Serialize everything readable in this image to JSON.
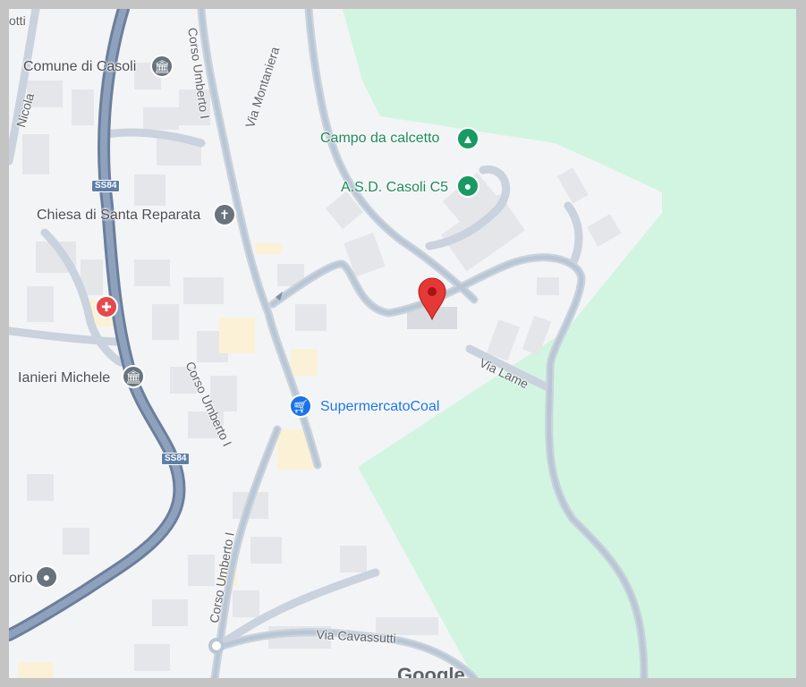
{
  "map": {
    "streets": {
      "corso_umberto_top": "Corso Umberto I",
      "via_montaniera": "Via Montaniera",
      "corso_umberto_mid": "Corso Umberto I",
      "corso_umberto_bottom": "Corso Umberto I",
      "via_lame": "Via Lame",
      "via_cavassutti": "Via Cavassutti",
      "nicola_partial": "Nicola",
      "otti_partial": "otti"
    },
    "shields": {
      "ss84_top": "SS84",
      "ss84_bottom": "SS84"
    },
    "places": {
      "comune": "Comune di Casoli",
      "campo": "Campo da calcetto",
      "asd": "A.S.D. Casoli C5",
      "chiesa": "Chiesa di Santa Reparata",
      "ianieri": "Ianieri Michele",
      "supermercato": "SupermercatoCoal",
      "orio_partial": "orio"
    },
    "icons": {
      "comune": "landmark-icon",
      "campo": "tree-icon",
      "asd": "location-dot-icon",
      "chiesa": "church-cross-icon",
      "ianieri": "landmark-icon",
      "supermercato": "shopping-cart-icon",
      "hospital": "medical-icon",
      "orio": "location-dot-icon",
      "pin": "map-pin-icon"
    },
    "colors": {
      "park": "#d2f5e2",
      "land": "#f3f4f6",
      "road": "#b9c6d4",
      "highway": "#7f93ae",
      "pin": "#e53935"
    },
    "attribution": "Google"
  }
}
